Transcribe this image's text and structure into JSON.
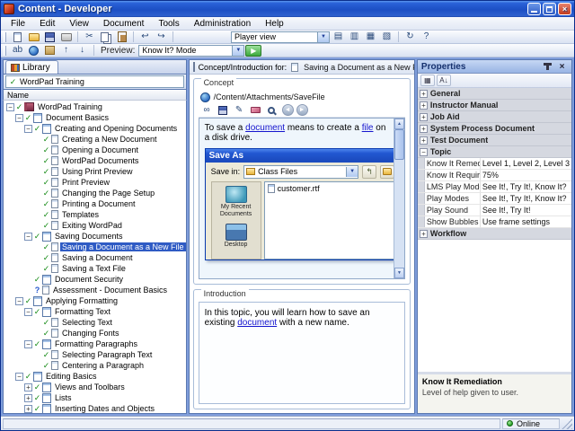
{
  "window": {
    "title": "Content - Developer",
    "online_label": "Online"
  },
  "menu": {
    "items": [
      "File",
      "Edit",
      "View",
      "Document",
      "Tools",
      "Administration",
      "Help"
    ]
  },
  "toolbar1": {
    "player_view_value": "Player view"
  },
  "toolbar2": {
    "preview_label": "Preview:",
    "preview_value": "Know It? Mode"
  },
  "library": {
    "tab_label": "Library",
    "selector_value": "WordPad Training",
    "column_header": "Name",
    "tree": [
      {
        "label": "WordPad Training",
        "level": 0,
        "exp": "minus",
        "mark": "check",
        "icon": "book",
        "sel": false
      },
      {
        "label": "Document Basics",
        "level": 1,
        "exp": "minus",
        "mark": "check",
        "icon": "pages",
        "sel": false
      },
      {
        "label": "Creating and Opening Documents",
        "level": 2,
        "exp": "minus",
        "mark": "check",
        "icon": "pages",
        "sel": false
      },
      {
        "label": "Creating a New Document",
        "level": 3,
        "exp": null,
        "mark": "check",
        "icon": "doc",
        "sel": false
      },
      {
        "label": "Opening a Document",
        "level": 3,
        "exp": null,
        "mark": "check",
        "icon": "doc",
        "sel": false
      },
      {
        "label": "WordPad Documents",
        "level": 3,
        "exp": null,
        "mark": "check",
        "icon": "doc",
        "sel": false
      },
      {
        "label": "Using Print Preview",
        "level": 3,
        "exp": null,
        "mark": "check",
        "icon": "doc",
        "sel": false
      },
      {
        "label": "Print Preview",
        "level": 3,
        "exp": null,
        "mark": "check",
        "icon": "doc",
        "sel": false
      },
      {
        "label": "Changing the Page Setup",
        "level": 3,
        "exp": null,
        "mark": "check",
        "icon": "doc",
        "sel": false
      },
      {
        "label": "Printing a Document",
        "level": 3,
        "exp": null,
        "mark": "check",
        "icon": "doc",
        "sel": false
      },
      {
        "label": "Templates",
        "level": 3,
        "exp": null,
        "mark": "check",
        "icon": "doc",
        "sel": false
      },
      {
        "label": "Exiting WordPad",
        "level": 3,
        "exp": null,
        "mark": "check",
        "icon": "doc",
        "sel": false
      },
      {
        "label": "Saving Documents",
        "level": 2,
        "exp": "minus",
        "mark": "check",
        "icon": "pages",
        "sel": false
      },
      {
        "label": "Saving a Document as a New File",
        "level": 3,
        "exp": null,
        "mark": "check",
        "icon": "doc",
        "sel": true
      },
      {
        "label": "Saving a Document",
        "level": 3,
        "exp": null,
        "mark": "check",
        "icon": "doc",
        "sel": false
      },
      {
        "label": "Saving a Text File",
        "level": 3,
        "exp": null,
        "mark": "check",
        "icon": "doc",
        "sel": false
      },
      {
        "label": "Document Security",
        "level": 2,
        "exp": null,
        "mark": "check",
        "icon": "pages",
        "sel": false
      },
      {
        "label": "Assessment - Document Basics",
        "level": 2,
        "exp": null,
        "mark": "question",
        "icon": "doc",
        "sel": false
      },
      {
        "label": "Applying Formatting",
        "level": 1,
        "exp": "minus",
        "mark": "check",
        "icon": "pages",
        "sel": false
      },
      {
        "label": "Formatting Text",
        "level": 2,
        "exp": "minus",
        "mark": "check",
        "icon": "pages",
        "sel": false
      },
      {
        "label": "Selecting Text",
        "level": 3,
        "exp": null,
        "mark": "check",
        "icon": "doc",
        "sel": false
      },
      {
        "label": "Changing Fonts",
        "level": 3,
        "exp": null,
        "mark": "check",
        "icon": "doc",
        "sel": false
      },
      {
        "label": "Formatting Paragraphs",
        "level": 2,
        "exp": "minus",
        "mark": "check",
        "icon": "pages",
        "sel": false
      },
      {
        "label": "Selecting Paragraph Text",
        "level": 3,
        "exp": null,
        "mark": "check",
        "icon": "doc",
        "sel": false
      },
      {
        "label": "Centering a Paragraph",
        "level": 3,
        "exp": null,
        "mark": "check",
        "icon": "doc",
        "sel": false
      },
      {
        "label": "Editing Basics",
        "level": 1,
        "exp": "minus",
        "mark": "check",
        "icon": "pages",
        "sel": false
      },
      {
        "label": "Views and Toolbars",
        "level": 2,
        "exp": "plus",
        "mark": "check",
        "icon": "pages",
        "sel": false
      },
      {
        "label": "Lists",
        "level": 2,
        "exp": "plus",
        "mark": "check",
        "icon": "pages",
        "sel": false
      },
      {
        "label": "Inserting Dates and Objects",
        "level": 2,
        "exp": "plus",
        "mark": "check",
        "icon": "pages",
        "sel": false
      }
    ]
  },
  "content": {
    "header_prefix": "Concept/Introduction for:",
    "header_title": "Saving a Document as a New File",
    "concept": {
      "legend": "Concept",
      "path": "/Content/Attachments/SaveFile",
      "sentence": [
        {
          "t": "To save a "
        },
        {
          "t": "document",
          "link": true
        },
        {
          "t": " means to create a "
        },
        {
          "t": "file",
          "link": true
        },
        {
          "t": " on a disk drive."
        }
      ],
      "dialog": {
        "title": "Save As",
        "save_in_label": "Save in:",
        "folder_value": "Class Files",
        "file_name": "customer.rtf",
        "places": [
          "My Recent Documents",
          "Desktop"
        ]
      }
    },
    "introduction": {
      "legend": "Introduction",
      "sentence": [
        {
          "t": "In this topic, you will learn how to save an existing "
        },
        {
          "t": "document",
          "link": true
        },
        {
          "t": " with a new name."
        }
      ]
    }
  },
  "properties": {
    "title": "Properties",
    "groups": [
      {
        "label": "General",
        "rows": []
      },
      {
        "label": "Instructor Manual",
        "rows": []
      },
      {
        "label": "Job Aid",
        "rows": []
      },
      {
        "label": "System Process Document",
        "rows": []
      },
      {
        "label": "Test Document",
        "rows": []
      },
      {
        "label": "Topic",
        "rows": [
          {
            "name": "Know It Remediation",
            "value": "Level 1, Level 2, Level 3"
          },
          {
            "name": "Know It Required %",
            "value": "75%"
          },
          {
            "name": "LMS Play Modes",
            "value": "See It!, Try It!, Know It?"
          },
          {
            "name": "Play Modes",
            "value": "See It!, Try It!, Know It?"
          },
          {
            "name": "Play Sound",
            "value": "See It!, Try It!"
          },
          {
            "name": "Show Bubbles",
            "value": "Use frame settings"
          }
        ]
      },
      {
        "label": "Workflow",
        "rows": []
      }
    ],
    "description": {
      "title": "Know It Remediation",
      "text": "Level of help given to user."
    }
  }
}
